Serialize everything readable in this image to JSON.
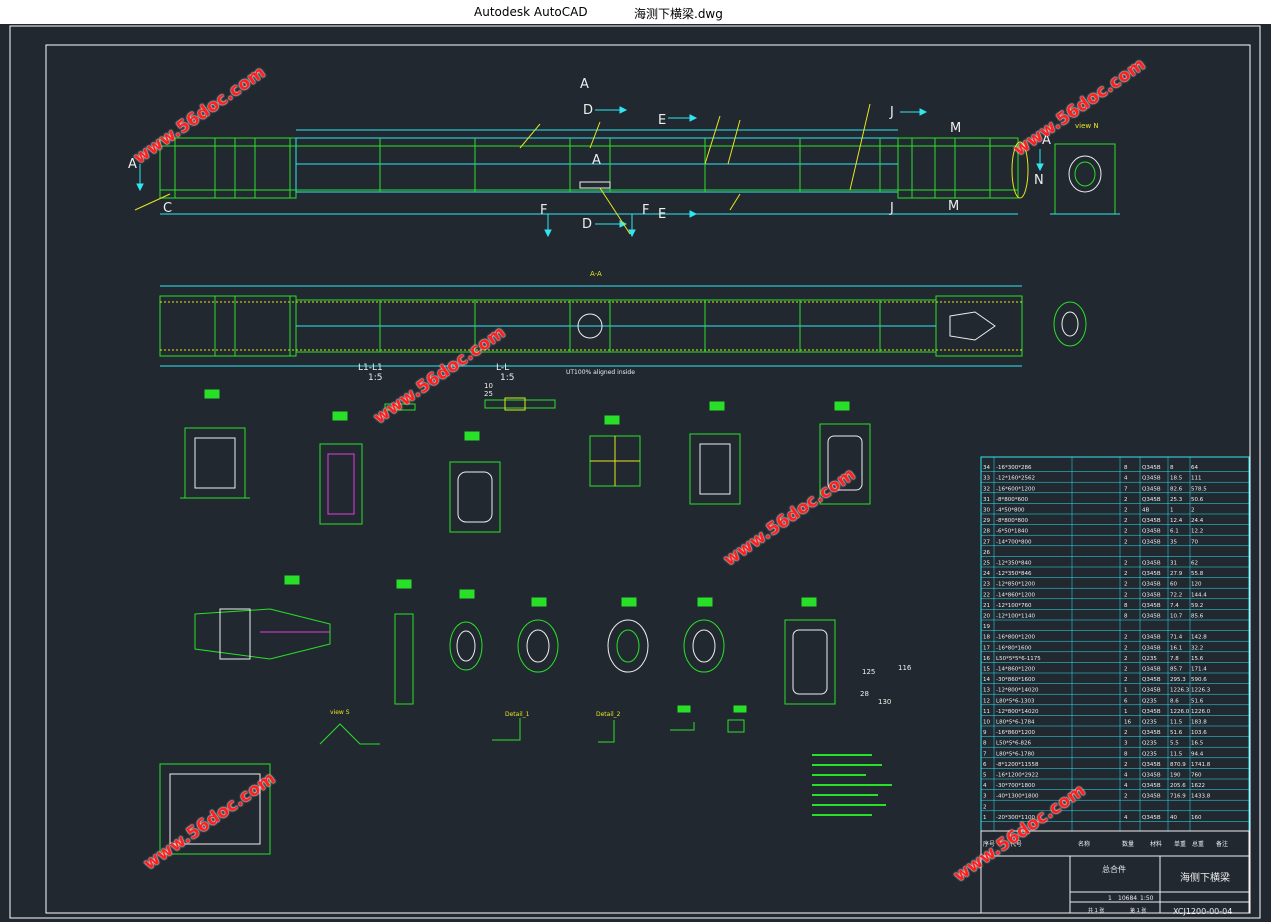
{
  "window": {
    "app_name": "Autodesk AutoCAD",
    "file_name": "海测下横梁.dwg"
  },
  "watermark": "www.56doc.com",
  "section_labels": {
    "A": "A",
    "C": "C",
    "D": "D",
    "E": "E",
    "F": "F",
    "J": "J",
    "M": "M",
    "N": "N",
    "view_n": "view N",
    "section_aa": "A-A",
    "l1": "L1-L1",
    "l": "L-L",
    "scale": "1:5",
    "weld_note": "UT100% aligned inside",
    "view_s": "view S",
    "detail_1": "Detail_1",
    "detail_2": "Detail_2",
    "dim_10": "10",
    "dim_25": "25",
    "dim_125": "125",
    "dim_130": "130",
    "dim_28": "28",
    "dim_116": "116"
  },
  "bom": {
    "rows": [
      {
        "no": "34",
        "name": "-16*300*286",
        "qty": "8",
        "mat": "Q345B",
        "w1": "8",
        "w2": "64"
      },
      {
        "no": "33",
        "name": "-12*160*2562",
        "qty": "4",
        "mat": "Q345B",
        "w1": "18.5",
        "w2": "111"
      },
      {
        "no": "32",
        "name": "-16*600*1200",
        "qty": "7",
        "mat": "Q345B",
        "w1": "82.6",
        "w2": "578.5"
      },
      {
        "no": "31",
        "name": "-8*800*600",
        "qty": "2",
        "mat": "Q345B",
        "w1": "25.3",
        "w2": "50.6"
      },
      {
        "no": "30",
        "name": "-4*50*800",
        "qty": "2",
        "mat": "4B",
        "w1": "1",
        "w2": "2"
      },
      {
        "no": "29",
        "name": "-8*800*800",
        "qty": "2",
        "mat": "Q345B",
        "w1": "12.4",
        "w2": "24.4"
      },
      {
        "no": "28",
        "name": "-6*50*1840",
        "qty": "2",
        "mat": "Q345B",
        "w1": "6.1",
        "w2": "12.2"
      },
      {
        "no": "27",
        "name": "-14*700*800",
        "qty": "2",
        "mat": "Q345B",
        "w1": "35",
        "w2": "70"
      },
      {
        "no": "26",
        "name": "",
        "qty": "",
        "mat": "",
        "w1": "",
        "w2": ""
      },
      {
        "no": "25",
        "name": "-12*350*840",
        "qty": "2",
        "mat": "Q345B",
        "w1": "31",
        "w2": "62"
      },
      {
        "no": "24",
        "name": "-12*350*846",
        "qty": "2",
        "mat": "Q345B",
        "w1": "27.9",
        "w2": "55.8"
      },
      {
        "no": "23",
        "name": "-12*850*1200",
        "qty": "2",
        "mat": "Q345B",
        "w1": "60",
        "w2": "120"
      },
      {
        "no": "22",
        "name": "-14*860*1200",
        "qty": "2",
        "mat": "Q345B",
        "w1": "72.2",
        "w2": "144.4"
      },
      {
        "no": "21",
        "name": "-12*100*760",
        "qty": "8",
        "mat": "Q345B",
        "w1": "7.4",
        "w2": "59.2"
      },
      {
        "no": "20",
        "name": "-12*100*1140",
        "qty": "8",
        "mat": "Q345B",
        "w1": "10.7",
        "w2": "85.6"
      },
      {
        "no": "19",
        "name": "",
        "qty": "",
        "mat": "",
        "w1": "",
        "w2": ""
      },
      {
        "no": "18",
        "name": "-16*800*1200",
        "qty": "2",
        "mat": "Q345B",
        "w1": "71.4",
        "w2": "142.8"
      },
      {
        "no": "17",
        "name": "-16*80*1600",
        "qty": "2",
        "mat": "Q345B",
        "w1": "16.1",
        "w2": "32.2"
      },
      {
        "no": "16",
        "name": "L50*5*5*6-1175",
        "qty": "2",
        "mat": "Q235",
        "w1": "7.8",
        "w2": "15.6"
      },
      {
        "no": "15",
        "name": "-14*860*1200",
        "qty": "2",
        "mat": "Q345B",
        "w1": "85.7",
        "w2": "171.4"
      },
      {
        "no": "14",
        "name": "-30*860*1600",
        "qty": "2",
        "mat": "Q345B",
        "w1": "295.3",
        "w2": "590.6"
      },
      {
        "no": "13",
        "name": "-12*800*14020",
        "qty": "1",
        "mat": "Q345B",
        "w1": "1226.3",
        "w2": "1226.3"
      },
      {
        "no": "12",
        "name": "L80*5*6-1303",
        "qty": "6",
        "mat": "Q235",
        "w1": "8.6",
        "w2": "51.6"
      },
      {
        "no": "11",
        "name": "-12*800*14020",
        "qty": "1",
        "mat": "Q345B",
        "w1": "1226.0",
        "w2": "1226.0"
      },
      {
        "no": "10",
        "name": "L80*5*6-1784",
        "qty": "16",
        "mat": "Q235",
        "w1": "11.5",
        "w2": "183.8"
      },
      {
        "no": "9",
        "name": "-16*860*1200",
        "qty": "2",
        "mat": "Q345B",
        "w1": "51.6",
        "w2": "103.6"
      },
      {
        "no": "8",
        "name": "L50*5*6-826",
        "qty": "3",
        "mat": "Q235",
        "w1": "5.5",
        "w2": "16.5"
      },
      {
        "no": "7",
        "name": "L80*5*6-1780",
        "qty": "8",
        "mat": "Q235",
        "w1": "11.5",
        "w2": "94.4"
      },
      {
        "no": "6",
        "name": "-8*1200*11558",
        "qty": "2",
        "mat": "Q345B",
        "w1": "870.9",
        "w2": "1741.8"
      },
      {
        "no": "5",
        "name": "-16*1200*2922",
        "qty": "4",
        "mat": "Q345B",
        "w1": "190",
        "w2": "760"
      },
      {
        "no": "4",
        "name": "-30*700*1800",
        "qty": "4",
        "mat": "Q345B",
        "w1": "205.6",
        "w2": "1622"
      },
      {
        "no": "3",
        "name": "-40*1300*1800",
        "qty": "2",
        "mat": "Q345B",
        "w1": "716.9",
        "w2": "1433.8"
      },
      {
        "no": "2",
        "name": "",
        "qty": "",
        "mat": "",
        "w1": "",
        "w2": ""
      },
      {
        "no": "1",
        "name": "-20*300*1100",
        "qty": "4",
        "mat": "Q345B",
        "w1": "40",
        "w2": "160"
      }
    ],
    "header": {
      "no": "序号",
      "code": "代号",
      "name": "名称",
      "qty": "数量",
      "mat": "材料",
      "w_single": "单重",
      "w_total": "总重",
      "note": "备注"
    }
  },
  "title_block": {
    "title": "海侧下横梁",
    "drawing_no": "XCJ1200-00-04",
    "assembly": "总合件",
    "weight": "10684",
    "scale": "1:50",
    "sheet": "共 1 张",
    "page": "第 1 张",
    "count": "1"
  },
  "colors": {
    "background": "#212830",
    "green": "#29e029",
    "cyan": "#30e6f0",
    "yellow": "#e6e61e",
    "white": "#eeeeee",
    "magenta": "#e040e0",
    "watermark": "#ff2020"
  }
}
